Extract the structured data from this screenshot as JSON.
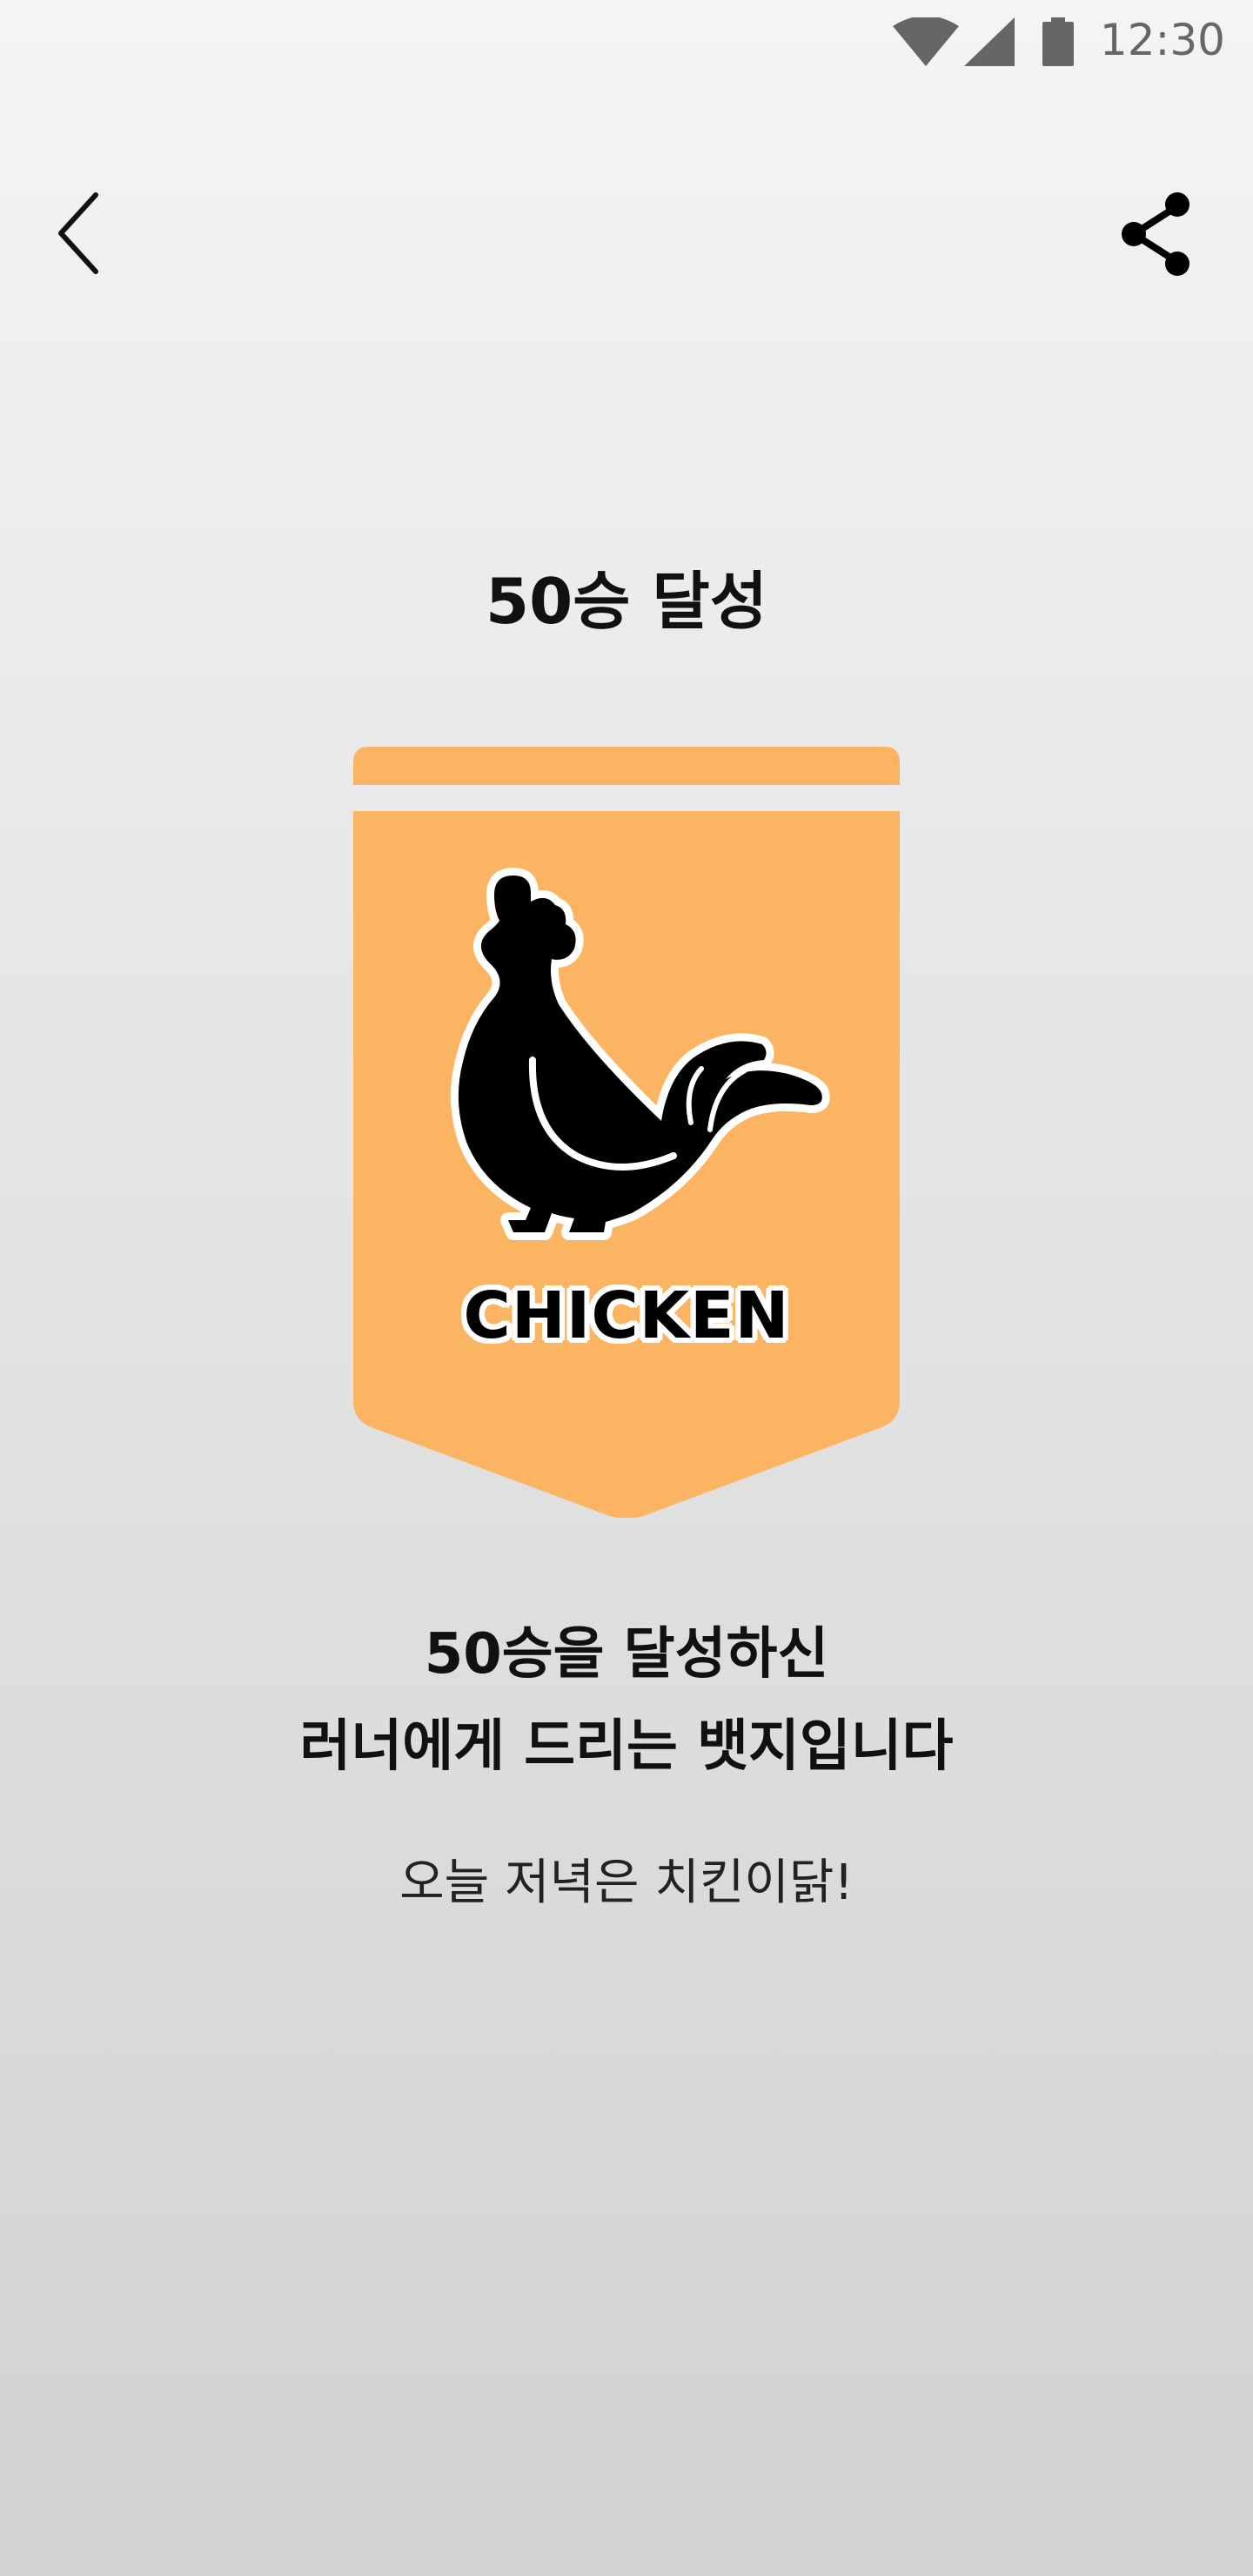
{
  "status_bar": {
    "time": "12:30",
    "icons": [
      "wifi-icon",
      "signal-icon",
      "battery-icon"
    ]
  },
  "toolbar": {
    "back_icon": "chevron-left-icon",
    "share_icon": "share-icon"
  },
  "achievement": {
    "title": "50승 달성",
    "badge_label": "CHICKEN",
    "badge_icon": "rooster-icon",
    "description_line1": "50승을 달성하신",
    "description_line2": "러너에게 드리는 뱃지입니다",
    "subtext": "오늘 저녁은 치킨이닭!"
  },
  "colors": {
    "badge_fill": "#fbb461",
    "icon": "#000000",
    "outline": "#ffffff"
  }
}
